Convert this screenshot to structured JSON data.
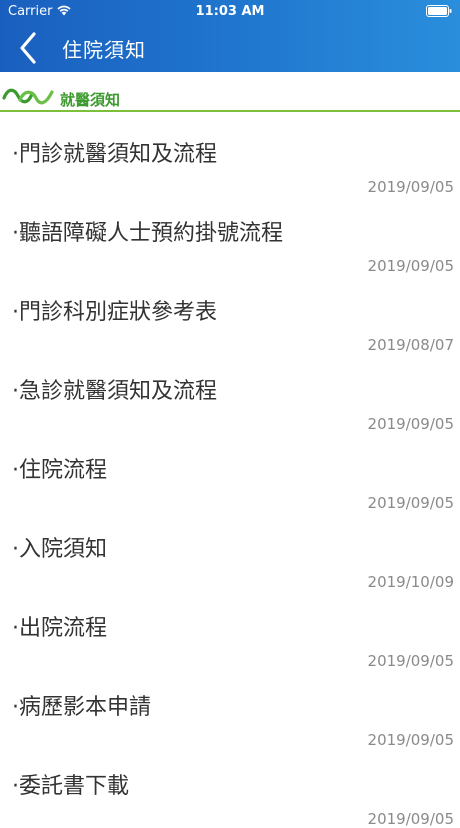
{
  "status_bar": {
    "carrier": "Carrier",
    "time": "11:03 AM"
  },
  "nav": {
    "title": "住院須知",
    "back_icon": "chevron-left-icon"
  },
  "section": {
    "title": "就醫須知",
    "logo_icon": "green-wave-logo-icon"
  },
  "colors": {
    "header_gradient_start": "#1a5fbf",
    "header_gradient_end": "#2a8edc",
    "section_green": "#3d9a2e",
    "divider_green": "#7bbf3a",
    "item_text": "#333333",
    "date_text": "#8a8a8a"
  },
  "items": [
    {
      "title": "·門診就醫須知及流程",
      "date": "2019/09/05"
    },
    {
      "title": "·聽語障礙人士預約掛號流程",
      "date": "2019/09/05"
    },
    {
      "title": "·門診科別症狀參考表",
      "date": "2019/08/07"
    },
    {
      "title": "·急診就醫須知及流程",
      "date": "2019/09/05"
    },
    {
      "title": "·住院流程",
      "date": "2019/09/05"
    },
    {
      "title": "·入院須知",
      "date": "2019/10/09"
    },
    {
      "title": "·出院流程",
      "date": "2019/09/05"
    },
    {
      "title": "·病歷影本申請",
      "date": "2019/09/05"
    },
    {
      "title": "·委託書下載",
      "date": "2019/09/05"
    }
  ]
}
